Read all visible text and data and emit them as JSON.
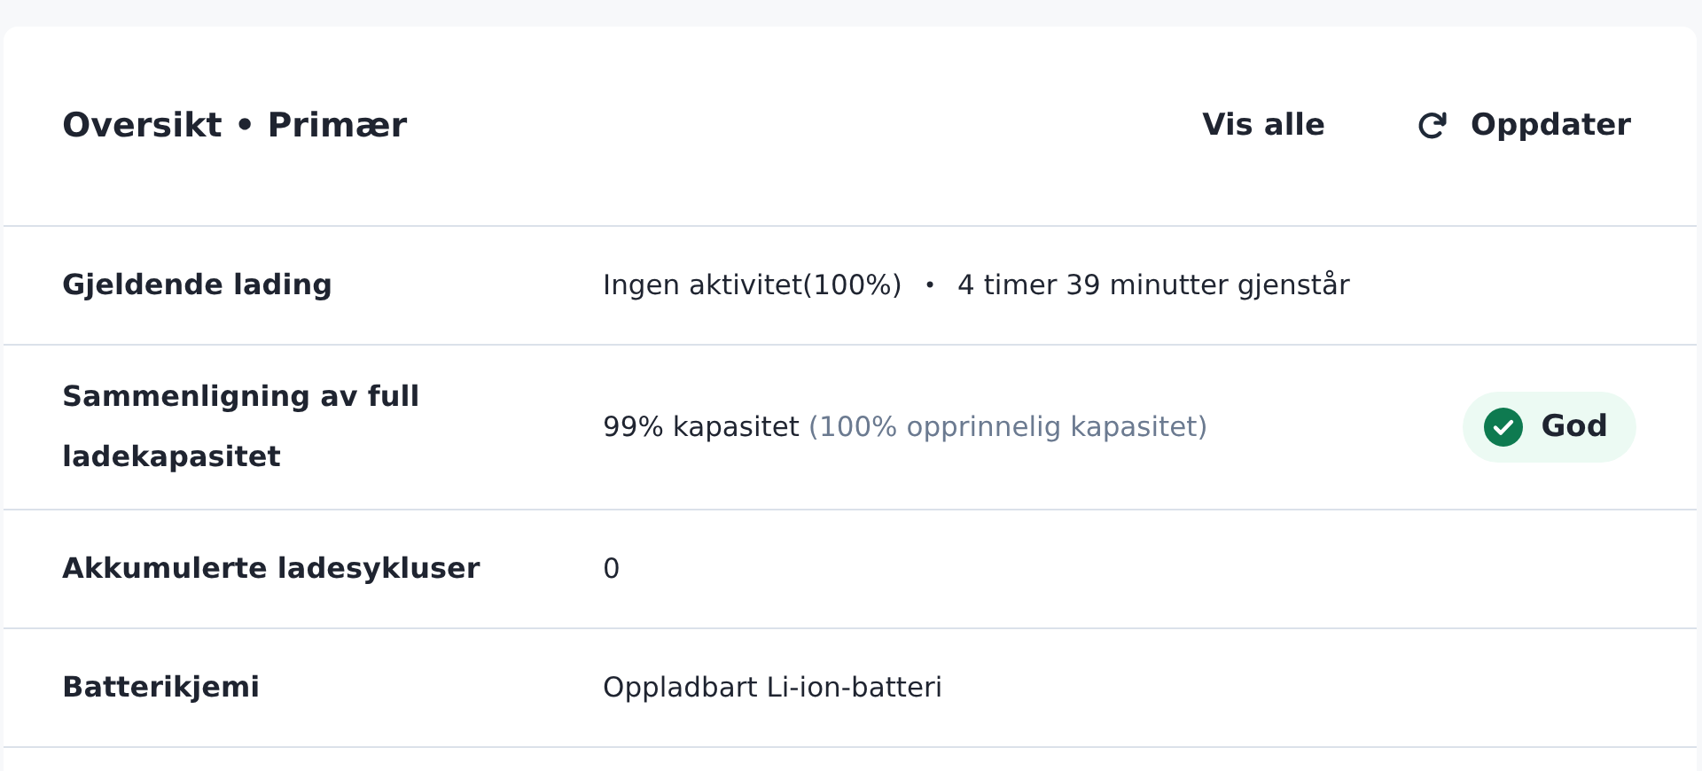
{
  "header": {
    "title": "Oversikt • Primær",
    "actions": [
      {
        "label": "Vis alle",
        "kind": "link"
      },
      {
        "label": "Oppdater",
        "kind": "refresh"
      }
    ]
  },
  "rows": [
    {
      "label": "Gjeldende lading",
      "value": "Ingen aktivitet(100%)",
      "separator": "•",
      "extra": "4 timer 39 minutter gjenstår"
    },
    {
      "label": "Sammenligning av full ladekapasitet",
      "value": "99% kapasitet",
      "note": "(100% opprinnelig kapasitet)",
      "badge": {
        "label": "God",
        "color": "#0e7a50"
      }
    },
    {
      "label": "Akkumulerte ladesykluser",
      "value": "0"
    },
    {
      "label": "Batterikjemi",
      "value": "Oppladbart Li-ion-batteri"
    }
  ]
}
